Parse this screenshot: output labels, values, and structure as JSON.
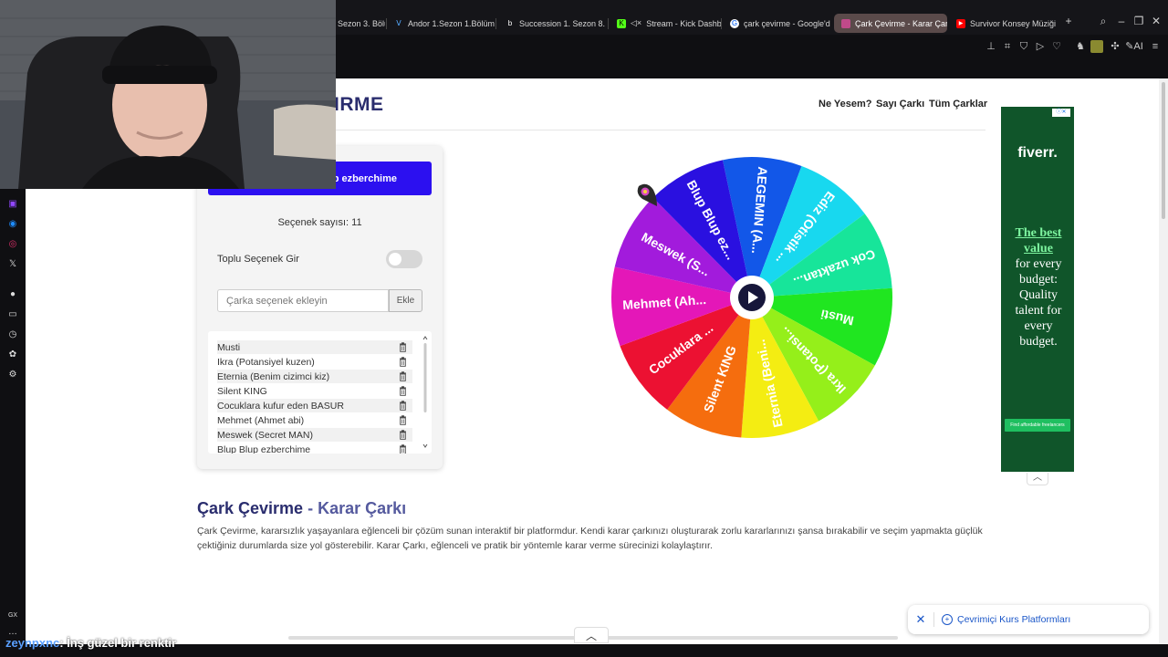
{
  "browser": {
    "tabs": [
      {
        "label": "Sezon 3. Bölü",
        "active": false
      },
      {
        "label": "Andor 1.Sezon 1.Bölüm -",
        "active": false
      },
      {
        "label": "Succession 1. Sezon 8. B",
        "active": false
      },
      {
        "label": "Stream - Kick Dashbo",
        "active": false
      },
      {
        "label": "çark çevirme - Google'd",
        "active": false
      },
      {
        "label": "Çark Çevirme - Karar Çarkı",
        "active": true
      },
      {
        "label": "Survivor Konsey Müziği |",
        "active": false
      }
    ],
    "new_tab": "+"
  },
  "site": {
    "logo": "IRME",
    "nav": [
      "Ne Yesem?",
      "Sayı Çarkı",
      "Tüm Çarklar"
    ]
  },
  "panel": {
    "winner_text": "p ezberchime",
    "option_count": "Seçenek sayısı: 11",
    "bulk_label": "Toplu Seçenek Gir",
    "bulk_enabled": false,
    "input_placeholder": "Çarka seçenek ekleyin",
    "add_label": "Ekle",
    "options": [
      "Musti",
      "Ikra (Potansiyel kuzen)",
      "Eternia (Benim cizimci kiz)",
      "Silent KING",
      "Cocuklara kufur eden BASUR",
      "Mehmet (Ahmet abi)",
      "Meswek (Secret MAN)",
      "Blup Blup ezberchime"
    ]
  },
  "wheel": {
    "segments": [
      {
        "label": "AEGEMIN (A...",
        "color": "#1257e8"
      },
      {
        "label": "Ediz (Otistik ...",
        "color": "#18d8ef"
      },
      {
        "label": "Cok uzaktan...",
        "color": "#17e59a"
      },
      {
        "label": "Musti",
        "color": "#20e620"
      },
      {
        "label": "Ikra (Potansi...",
        "color": "#95ef1a"
      },
      {
        "label": "Eternia (Beni...",
        "color": "#f4ed12"
      },
      {
        "label": "Silent KING",
        "color": "#f56d0e"
      },
      {
        "label": "Cocuklara ...",
        "color": "#ec1132"
      },
      {
        "label": "Mehmet (Ah...",
        "color": "#e417b8"
      },
      {
        "label": "Meswek (S...",
        "color": "#a21bdc"
      },
      {
        "label": "Blup Blup ez...",
        "color": "#2a10e0"
      }
    ],
    "center_icon": "play-icon"
  },
  "content": {
    "title_part1": "Çark Çevirme",
    "title_sep": " - ",
    "title_part2": "Karar Çarkı",
    "description": "Çark Çevirme, kararsızlık yaşayanlara eğlenceli bir çözüm sunan interaktif bir platformdur. Kendi karar çarkınızı oluşturarak zorlu kararlarınızı şansa bırakabilir ve seçim yapmakta güçlük çektiğiniz durumlarda size yol gösterebilir. Karar Çarkı, eğlenceli ve pratik bir yöntemle karar verme sürecinizi kolaylaştırır."
  },
  "ad": {
    "brand": "fiverr.",
    "highlight": "The best value",
    "body": "for every budget: Quality talent for every budget.",
    "cta": "Find affordable freelancers"
  },
  "suggestion": {
    "label": "Çevrimiçi Kurs Platformları"
  },
  "stream_chat": {
    "user": "zeynpxnc",
    "message": ": İnş güzel bir renktir"
  },
  "sidebar_label": "GX"
}
